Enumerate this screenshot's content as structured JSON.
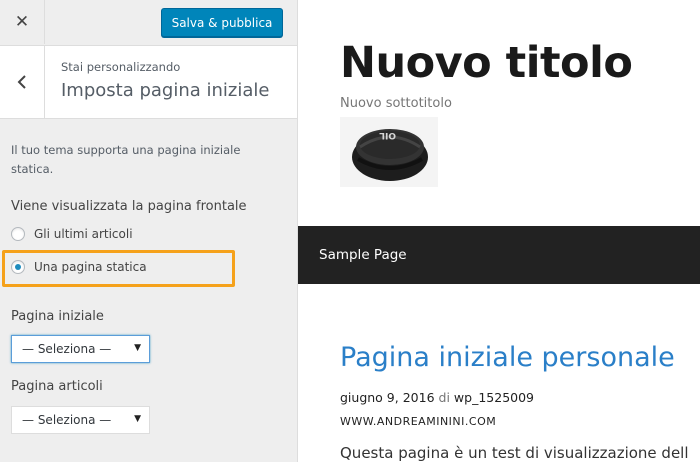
{
  "topbar": {
    "close_glyph": "✕",
    "publish_label": "Salva & pubblica",
    "publish_color": "#0085ba"
  },
  "section": {
    "subtitle": "Stai personalizzando",
    "title": "Imposta pagina iniziale",
    "back_icon": "chevron-left-icon"
  },
  "settings": {
    "description": "Il tuo tema supporta una pagina iniziale statica.",
    "front_page_label": "Viene visualizzata la pagina frontale",
    "options": [
      {
        "label": "Gli ultimi articoli",
        "selected": false
      },
      {
        "label": "Una pagina statica",
        "selected": true
      }
    ],
    "highlight_color": "#f5a11a",
    "homepage_label": "Pagina iniziale",
    "homepage_value": "— Seleziona —",
    "posts_page_label": "Pagina articoli",
    "posts_page_value": "— Seleziona —"
  },
  "preview": {
    "site_title": "Nuovo titolo",
    "tagline": "Nuovo sottotitolo",
    "header_image_text": "OIL",
    "nav_items": [
      "Sample Page"
    ],
    "post_title": "Pagina iniziale personale",
    "post_date": "giugno 9, 2016",
    "post_by": "di",
    "post_author": "wp_1525009",
    "watermark": "WWW.ANDREAMININI.COM",
    "excerpt": "Questa pagina è un test di visualizzazione dell"
  }
}
